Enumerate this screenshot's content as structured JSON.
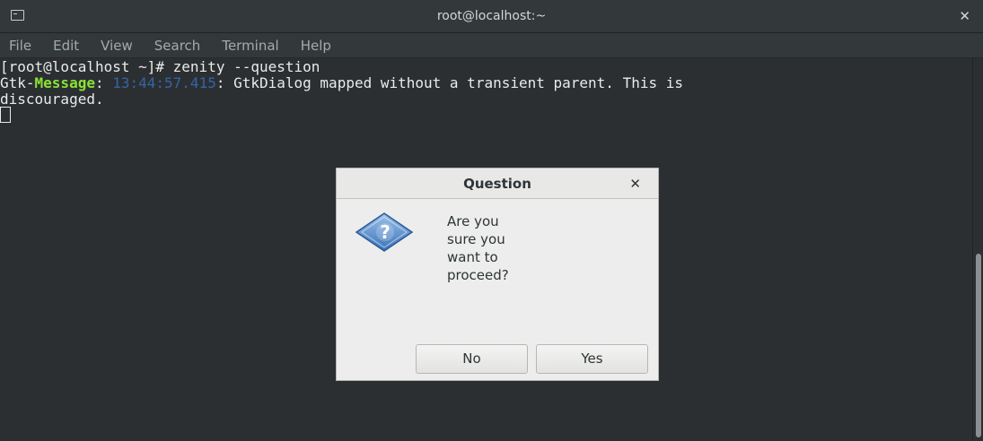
{
  "window": {
    "title": "root@localhost:~"
  },
  "menu": [
    "File",
    "Edit",
    "View",
    "Search",
    "Terminal",
    "Help"
  ],
  "terminal": {
    "line1": "[root@localhost ~]# zenity --question",
    "line2_prefix": "Gtk-",
    "line2_tag": "Message",
    "line2_colon": ": ",
    "line2_time": "13:44:57.415",
    "line2_rest": ": GtkDialog mapped without a transient parent. This is",
    "line3": "discouraged."
  },
  "dialog": {
    "title": "Question",
    "message_lines": [
      "Are you",
      "sure you",
      "want to",
      "proceed?"
    ],
    "no_label": "No",
    "yes_label": "Yes"
  },
  "colors": {
    "green": "#8ae234",
    "blue": "#3465a4",
    "terminal_bg": "#2b2f32"
  }
}
